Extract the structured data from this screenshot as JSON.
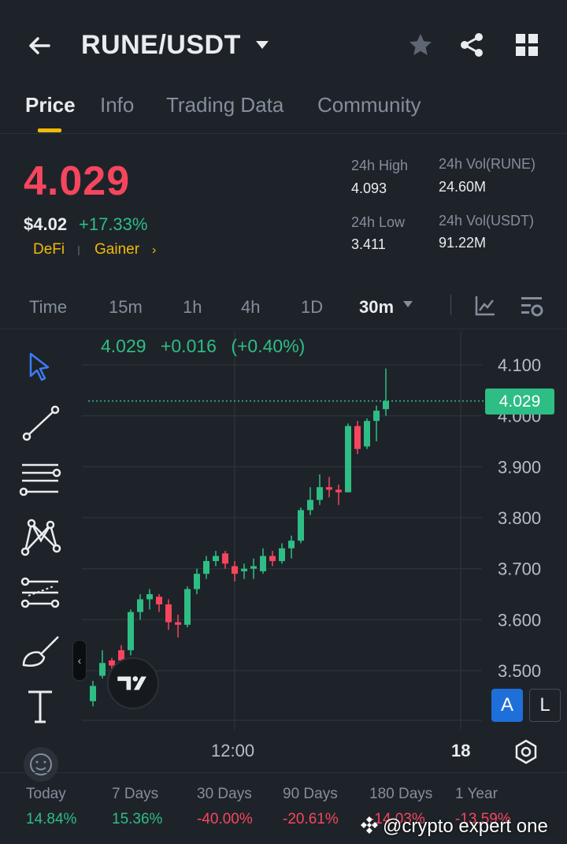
{
  "header": {
    "pair": "RUNE/USDT"
  },
  "tabs": [
    {
      "label": "Price",
      "active": true
    },
    {
      "label": "Info",
      "active": false
    },
    {
      "label": "Trading Data",
      "active": false
    },
    {
      "label": "Community",
      "active": false
    }
  ],
  "price": {
    "last": "4.029",
    "usd": "$4.02",
    "change": "+17.33%",
    "tags": [
      "DeFi",
      "Gainer"
    ]
  },
  "stats": {
    "high_label": "24h High",
    "high_value": "4.093",
    "low_label": "24h Low",
    "low_value": "3.411",
    "vol_base_label": "24h Vol(RUNE)",
    "vol_base_value": "24.60M",
    "vol_quote_label": "24h Vol(USDT)",
    "vol_quote_value": "91.22M"
  },
  "intervals": [
    {
      "label": "Time",
      "active": false
    },
    {
      "label": "15m",
      "active": false
    },
    {
      "label": "1h",
      "active": false
    },
    {
      "label": "4h",
      "active": false
    },
    {
      "label": "1D",
      "active": false
    },
    {
      "label": "30m",
      "active": true
    }
  ],
  "chart_overlay": {
    "close": "4.029",
    "change_abs": "+0.016",
    "change_pct": "(+0.40%)",
    "current_tag": "4.029",
    "btn_a": "A",
    "btn_l": "L",
    "x_label_1": "12:00",
    "x_label_2": "18"
  },
  "colors": {
    "up": "#2ebd85",
    "down": "#f6465d",
    "accent": "#f0b90b",
    "background": "#1e2329"
  },
  "chart_data": {
    "type": "candlestick",
    "ylim": [
      3.45,
      4.15
    ],
    "y_ticks": [
      "4.100",
      "4.000",
      "3.900",
      "3.800",
      "3.700",
      "3.600",
      "3.500"
    ],
    "x_ticks": [
      "12:00",
      "18"
    ],
    "grid": true,
    "current_price": 4.029,
    "candles": [
      {
        "o": 3.44,
        "h": 3.48,
        "l": 3.43,
        "c": 3.47
      },
      {
        "o": 3.49,
        "h": 3.54,
        "l": 3.485,
        "c": 3.515
      },
      {
        "o": 3.52,
        "h": 3.525,
        "l": 3.5,
        "c": 3.51
      },
      {
        "o": 3.54,
        "h": 3.55,
        "l": 3.51,
        "c": 3.52
      },
      {
        "o": 3.54,
        "h": 3.62,
        "l": 3.53,
        "c": 3.615
      },
      {
        "o": 3.615,
        "h": 3.65,
        "l": 3.6,
        "c": 3.64
      },
      {
        "o": 3.64,
        "h": 3.66,
        "l": 3.62,
        "c": 3.65
      },
      {
        "o": 3.645,
        "h": 3.65,
        "l": 3.615,
        "c": 3.63
      },
      {
        "o": 3.63,
        "h": 3.64,
        "l": 3.58,
        "c": 3.595
      },
      {
        "o": 3.595,
        "h": 3.61,
        "l": 3.565,
        "c": 3.59
      },
      {
        "o": 3.59,
        "h": 3.665,
        "l": 3.585,
        "c": 3.66
      },
      {
        "o": 3.66,
        "h": 3.7,
        "l": 3.65,
        "c": 3.69
      },
      {
        "o": 3.69,
        "h": 3.725,
        "l": 3.68,
        "c": 3.715
      },
      {
        "o": 3.715,
        "h": 3.735,
        "l": 3.705,
        "c": 3.725
      },
      {
        "o": 3.73,
        "h": 3.735,
        "l": 3.7,
        "c": 3.71
      },
      {
        "o": 3.705,
        "h": 3.715,
        "l": 3.675,
        "c": 3.69
      },
      {
        "o": 3.695,
        "h": 3.71,
        "l": 3.68,
        "c": 3.7
      },
      {
        "o": 3.7,
        "h": 3.72,
        "l": 3.68,
        "c": 3.705
      },
      {
        "o": 3.695,
        "h": 3.74,
        "l": 3.69,
        "c": 3.725
      },
      {
        "o": 3.725,
        "h": 3.735,
        "l": 3.705,
        "c": 3.715
      },
      {
        "o": 3.715,
        "h": 3.75,
        "l": 3.71,
        "c": 3.74
      },
      {
        "o": 3.74,
        "h": 3.765,
        "l": 3.72,
        "c": 3.755
      },
      {
        "o": 3.755,
        "h": 3.82,
        "l": 3.75,
        "c": 3.815
      },
      {
        "o": 3.815,
        "h": 3.86,
        "l": 3.805,
        "c": 3.835
      },
      {
        "o": 3.835,
        "h": 3.885,
        "l": 3.825,
        "c": 3.86
      },
      {
        "o": 3.86,
        "h": 3.88,
        "l": 3.84,
        "c": 3.855
      },
      {
        "o": 3.855,
        "h": 3.865,
        "l": 3.825,
        "c": 3.85
      },
      {
        "o": 3.85,
        "h": 3.985,
        "l": 3.85,
        "c": 3.98
      },
      {
        "o": 3.98,
        "h": 3.99,
        "l": 3.925,
        "c": 3.935
      },
      {
        "o": 3.94,
        "h": 3.995,
        "l": 3.935,
        "c": 3.99
      },
      {
        "o": 3.99,
        "h": 4.02,
        "l": 3.95,
        "c": 4.01
      },
      {
        "o": 4.013,
        "h": 4.093,
        "l": 4.0,
        "c": 4.029
      }
    ]
  },
  "performance": [
    {
      "label": "Today",
      "value": "14.84%",
      "dir": "up"
    },
    {
      "label": "7 Days",
      "value": "15.36%",
      "dir": "up"
    },
    {
      "label": "30 Days",
      "value": "-40.00%",
      "dir": "down"
    },
    {
      "label": "90 Days",
      "value": "-20.61%",
      "dir": "down"
    },
    {
      "label": "180 Days",
      "value": "-14.03%",
      "dir": "down"
    },
    {
      "label": "1 Year",
      "value": "-13.59%",
      "dir": "down"
    }
  ],
  "watermark": "@crypto expert one"
}
